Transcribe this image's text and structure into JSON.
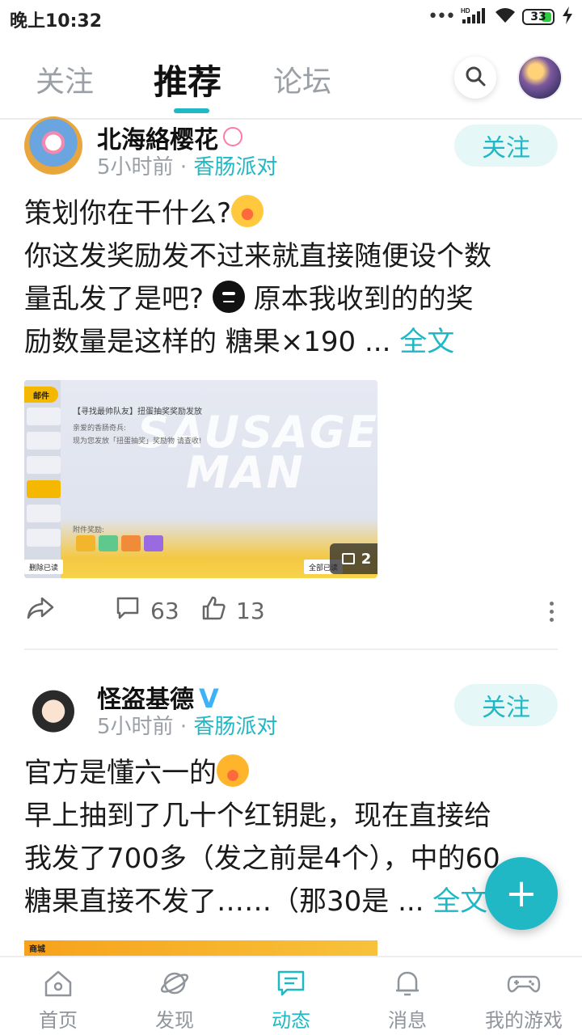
{
  "status_bar": {
    "time": "晚上10:32",
    "network": "HD",
    "battery": "33"
  },
  "top_tabs": {
    "items": [
      "关注",
      "推荐",
      "论坛"
    ],
    "active": "推荐"
  },
  "posts": [
    {
      "author": "北海絡樱花",
      "time": "5小时前",
      "separator": "·",
      "game": "香肠派对",
      "follow_label": "关注",
      "text_line1": "策划你在干什么?",
      "text_line2": "你这发奖励发不过来就直接随便设个数",
      "text_line3": "量乱发了是吧?",
      "text_line3b": " 原本我收到的的奖",
      "text_line4": "励数量是这样的 糖果×190  ...",
      "more_label": " 全文",
      "image": {
        "mail_tab": "邮件",
        "title": "【寻找最帅队友】扭蛋抽奖奖励发放",
        "greeting": "亲爱的香肠奇兵:",
        "body": "现为您发放「扭蛋抽奖」奖励物 请查收!",
        "attachments": "附件奖励:",
        "watermark_line1": "SAUSAGE",
        "watermark_line2": "MAN",
        "btn_delete": "删除已读",
        "btn_read_all": "全部已读",
        "image_count": "2"
      },
      "comments": "63",
      "likes": "13"
    },
    {
      "author": "怪盗基德",
      "verified": "V",
      "time": "5小时前",
      "separator": "·",
      "game": "香肠派对",
      "follow_label": "关注",
      "text_line1": "官方是懂六一的",
      "text_line2": "早上抽到了几十个红钥匙，现在直接给",
      "text_line3": "我发了700多（发之前是4个），中的60",
      "text_line4": "糖果直接不发了……（那30是 ...",
      "more_label": " 全文",
      "image": {
        "shop_label": "商城"
      }
    }
  ],
  "fab": {
    "label": "+"
  },
  "bottom_nav": {
    "items": [
      "首页",
      "发现",
      "动态",
      "消息",
      "我的游戏"
    ],
    "active": "动态"
  },
  "colors": {
    "accent": "#1fb8c4",
    "follow_bg": "#e6f7f8",
    "muted": "#9aa0a6"
  }
}
